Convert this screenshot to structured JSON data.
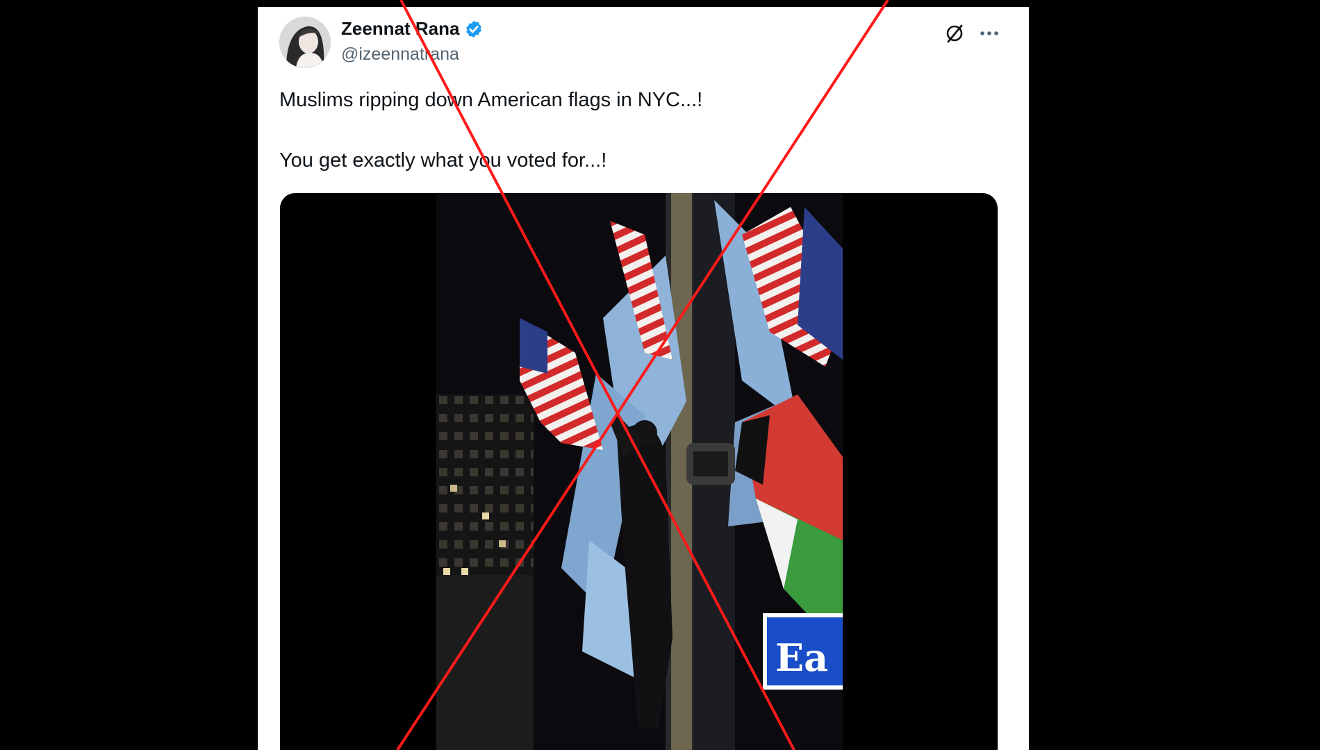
{
  "tweet": {
    "author": {
      "display_name": "Zeennat Rana",
      "handle": "@izeennatrana",
      "verified": true,
      "avatar_icon": "profile-photo"
    },
    "text_lines": [
      "Muslims ripping down American flags in NYC...!",
      "You get exactly what you voted for...!"
    ],
    "actions": {
      "grok_icon": "grok-icon",
      "more_icon": "more-options-icon"
    },
    "media": {
      "type": "video",
      "sign_text": "Ea"
    }
  },
  "overlay": {
    "mark": "red-x-cross",
    "color": "#ff1a1a"
  },
  "colors": {
    "verified_badge": "#1d9bf0",
    "text_primary": "#0f1419",
    "text_secondary": "#536471"
  }
}
